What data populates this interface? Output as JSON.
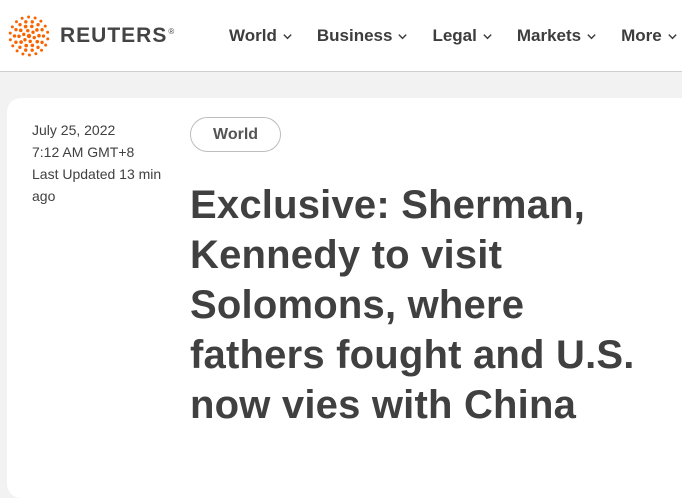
{
  "brand": {
    "name": "REUTERS",
    "registered_mark": "®",
    "accent_color": "#fa6400"
  },
  "nav": {
    "items": [
      {
        "label": "World",
        "icon": "chevron-down-icon"
      },
      {
        "label": "Business",
        "icon": "chevron-down-icon"
      },
      {
        "label": "Legal",
        "icon": "chevron-down-icon"
      },
      {
        "label": "Markets",
        "icon": "chevron-down-icon"
      },
      {
        "label": "More",
        "icon": "chevron-down-icon"
      }
    ]
  },
  "article": {
    "date": "July 25, 2022",
    "time": "7:12 AM GMT+8",
    "last_updated": "Last Updated 13 min ago",
    "section_tag": "World",
    "headline": "Exclusive: Sherman, Kennedy to visit Solomons, where fathers fought and U.S. now vies with China"
  }
}
